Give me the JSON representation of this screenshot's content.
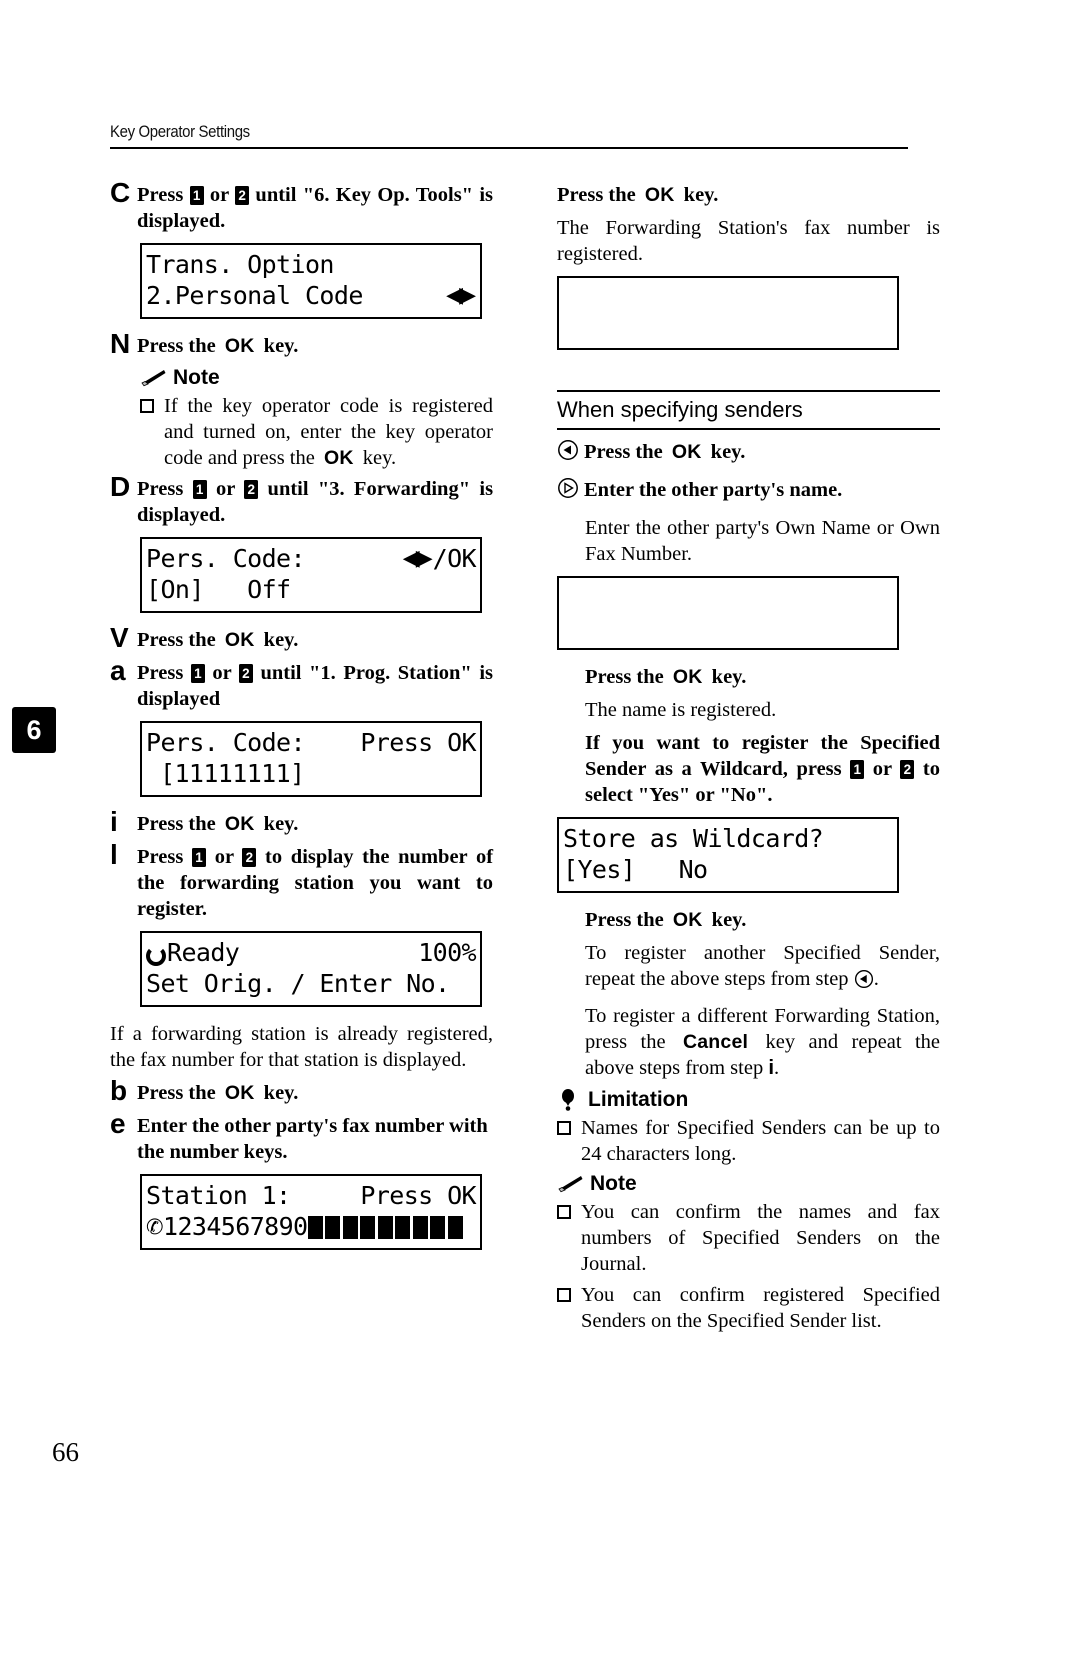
{
  "header": {
    "title": "Key Operator Settings"
  },
  "chapter_tab": "6",
  "page_number": "66",
  "keys": {
    "ok": "OK",
    "cancel": "Cancel",
    "key1": "1",
    "key2": "2"
  },
  "left_column": {
    "step_c": {
      "marker": "C",
      "text_1": "Press",
      "text_2": "or",
      "text_3": "until \"6. Key Op. Tools\" is displayed."
    },
    "lcd_trans_option": {
      "line1": "Trans. Option",
      "line2": "2.Personal Code",
      "arrows": "◀▶"
    },
    "step_n": {
      "marker": "N",
      "text": "Press the",
      "tail": "key."
    },
    "note_heading": "Note",
    "note_item_1a": "If the key operator code is registered and turned on, enter the key operator code and press the",
    "note_item_1b": "key.",
    "step_d": {
      "marker": "D",
      "text_1": "Press",
      "text_2": "or",
      "text_3": "until \"3. Forwarding\" is displayed."
    },
    "lcd_pers_code_onoff": {
      "label": "Pers. Code:",
      "arrows": "◀▶",
      "suffix": "/OK",
      "line2": "[On]   Off"
    },
    "step_v": {
      "marker": "V",
      "text": "Press the",
      "tail": "key."
    },
    "step_a": {
      "marker": "a",
      "text_1": "Press",
      "text_2": "or",
      "text_3": "until \"1. Prog. Station\" is displayed"
    },
    "lcd_pers_code_value": {
      "label": "Pers. Code:",
      "right": "Press OK",
      "line2": "[11111111]"
    },
    "step_i": {
      "marker": "i",
      "text": "Press the",
      "tail": "key."
    },
    "step_l": {
      "marker": "l",
      "text_1": "Press",
      "text_2": "or",
      "text_3": "to display the number of the forwarding station you want to register."
    },
    "lcd_ready": {
      "status": "Ready",
      "percent": "100%",
      "line2": "Set Orig. / Enter No."
    },
    "para_already_registered": "If a forwarding station is already registered, the fax number for that station is displayed.",
    "step_b": {
      "marker": "b",
      "text": "Press the",
      "tail": "key."
    },
    "step_e": {
      "marker": "e",
      "text": "Enter the other party's fax number with the number keys."
    },
    "lcd_station": {
      "label": "Station 1:",
      "right": "Press OK",
      "number": "1234567890",
      "blocks": 9
    }
  },
  "right_column": {
    "press_ok_1": {
      "text": "Press the",
      "tail": "key."
    },
    "para_fwd_registered": "The Forwarding Station's fax number is registered.",
    "section_title": "When specifying senders",
    "step_left_tri": {
      "marker": "◁",
      "text": "Press the",
      "tail": "key."
    },
    "step_right_tri": {
      "marker": "▷",
      "text": "Enter the other party's name."
    },
    "para_enter_own": "Enter the other party's Own Name or Own Fax Number.",
    "press_ok_2": {
      "text": "Press the",
      "tail": "key."
    },
    "para_name_registered": "The name is registered.",
    "para_wildcard_1": "If you want to register the Specified Sender as a Wildcard, press",
    "para_wildcard_2": "or",
    "para_wildcard_3": "to select \"Yes\" or \"No\".",
    "lcd_wildcard": {
      "line1": "Store as Wildcard?",
      "line2": "[Yes]   No"
    },
    "press_ok_3": {
      "text": "Press the",
      "tail": "key."
    },
    "para_register_another_1": "To register another Specified Sender, repeat the above steps from step",
    "para_register_another_2": "◁",
    "para_register_another_3": ".",
    "para_different_station_1": "To register a different Forwarding Station, press the",
    "para_different_station_2": "key and repeat the above steps from step",
    "para_different_station_3": "i",
    "para_different_station_4": ".",
    "limitation_heading": "Limitation",
    "limitation_item": "Names for Specified Senders can be up to 24 characters long.",
    "note_heading": "Note",
    "note_item_1": "You can confirm the names and fax numbers of Specified Senders on the Journal.",
    "note_item_2": "You can confirm registered Specified Senders on the Specified Sender list."
  }
}
